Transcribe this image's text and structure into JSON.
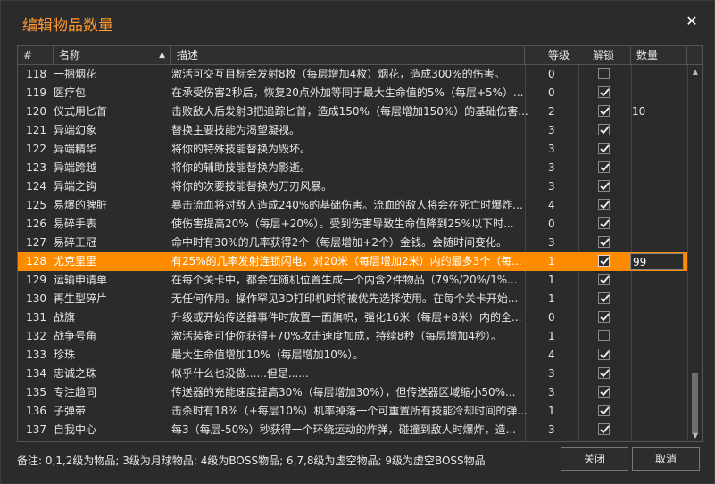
{
  "window": {
    "title": "编辑物品数量"
  },
  "columns": {
    "idx": "#",
    "name": "名称",
    "desc": "描述",
    "level": "等级",
    "unlock": "解锁",
    "qty": "数量"
  },
  "rows": [
    {
      "idx": "118",
      "name": "一捆烟花",
      "desc": "激活可交互目标会发射8枚（每层增加4枚）烟花，造成300%的伤害。",
      "level": "0",
      "unlocked": false,
      "qty": ""
    },
    {
      "idx": "119",
      "name": "医疗包",
      "desc": "在承受伤害2秒后，恢复20点外加等同于最大生命值的5%（每层+5%）...",
      "level": "0",
      "unlocked": true,
      "qty": ""
    },
    {
      "idx": "120",
      "name": "仪式用匕首",
      "desc": "击败敌人后发射3把追踪匕首，造成150%（每层增加150%）的基础伤害...",
      "level": "2",
      "unlocked": true,
      "qty": "10"
    },
    {
      "idx": "121",
      "name": "异端幻象",
      "desc": "替换主要技能为渴望凝视。",
      "level": "3",
      "unlocked": true,
      "qty": ""
    },
    {
      "idx": "122",
      "name": "异端精华",
      "desc": "将你的特殊技能替换为毁坏。",
      "level": "3",
      "unlocked": true,
      "qty": ""
    },
    {
      "idx": "123",
      "name": "异端跨越",
      "desc": "将你的辅助技能替换为影逝。",
      "level": "3",
      "unlocked": true,
      "qty": ""
    },
    {
      "idx": "124",
      "name": "异端之钩",
      "desc": "将你的次要技能替换为万刃风暴。",
      "level": "3",
      "unlocked": true,
      "qty": ""
    },
    {
      "idx": "125",
      "name": "易爆的脾脏",
      "desc": "暴击流血将对敌人造成240%的基础伤害。流血的敌人将会在死亡时爆炸...",
      "level": "4",
      "unlocked": true,
      "qty": ""
    },
    {
      "idx": "126",
      "name": "易碎手表",
      "desc": "使伤害提高20%（每层+20%）。受到伤害导致生命值降到25%以下时...",
      "level": "0",
      "unlocked": true,
      "qty": ""
    },
    {
      "idx": "127",
      "name": "易碎王冠",
      "desc": "命中时有30%的几率获得2个（每层增加+2个）金钱。会随时间变化。",
      "level": "3",
      "unlocked": true,
      "qty": ""
    },
    {
      "idx": "128",
      "name": "尤克里里",
      "desc": "有25%的几率发射连锁闪电，对20米（每层增加2米）内的最多3个（每...",
      "level": "1",
      "unlocked": true,
      "qty": "99",
      "selected": true
    },
    {
      "idx": "129",
      "name": "运输申请单",
      "desc": "在每个关卡中，都会在随机位置生成一个内含2件物品（79%/20%/1%...",
      "level": "1",
      "unlocked": true,
      "qty": ""
    },
    {
      "idx": "130",
      "name": "再生型碎片",
      "desc": "无任何作用。操作罕见3D打印机时将被优先选择使用。在每个关卡开始...",
      "level": "1",
      "unlocked": true,
      "qty": ""
    },
    {
      "idx": "131",
      "name": "战旗",
      "desc": "升级或开始传送器事件时放置一面旗帜，强化16米（每层+8米）内的全...",
      "level": "0",
      "unlocked": true,
      "qty": ""
    },
    {
      "idx": "132",
      "name": "战争号角",
      "desc": "激活装备可使你获得+70%攻击速度加成，持续8秒（每层增加4秒）。",
      "level": "1",
      "unlocked": false,
      "qty": ""
    },
    {
      "idx": "133",
      "name": "珍珠",
      "desc": "最大生命值增加10%（每层增加10%）。",
      "level": "4",
      "unlocked": true,
      "qty": ""
    },
    {
      "idx": "134",
      "name": "忠诚之珠",
      "desc": "似乎什么也没做......但是......",
      "level": "3",
      "unlocked": true,
      "qty": ""
    },
    {
      "idx": "135",
      "name": "专注趋同",
      "desc": "传送器的充能速度提高30%（每层增加30%），但传送器区域缩小50%...",
      "level": "3",
      "unlocked": true,
      "qty": ""
    },
    {
      "idx": "136",
      "name": "子弹带",
      "desc": "击杀时有18%（+每层10%）机率掉落一个可重置所有技能冷却时间的弹...",
      "level": "1",
      "unlocked": true,
      "qty": ""
    },
    {
      "idx": "137",
      "name": "自我中心",
      "desc": "每3（每层-50%）秒获得一个环绕运动的炸弹，碰撞到敌人时爆炸，造...",
      "level": "3",
      "unlocked": true,
      "qty": ""
    }
  ],
  "footer": {
    "note": "备注: 0,1,2级为物品; 3级为月球物品; 4级为BOSS物品; 6,7,8级为虚空物品; 9级为虚空BOSS物品"
  },
  "buttons": {
    "close": "关闭",
    "cancel": "取消"
  },
  "colors": {
    "accent": "#ff8c00",
    "title": "#ff9a2e"
  }
}
